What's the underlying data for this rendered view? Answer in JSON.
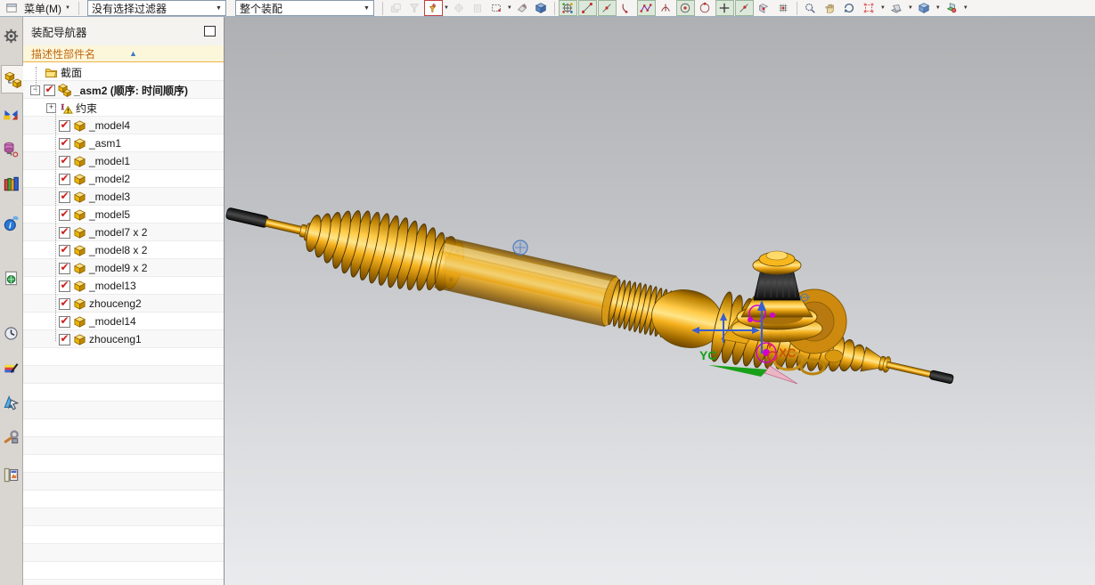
{
  "toolbar": {
    "menu_label": "菜单(M)",
    "selection_filter_value": "没有选择过滤器",
    "scope_value": "整个装配",
    "left_icons": [
      {
        "name": "show-component-icon",
        "state": "disabled"
      },
      {
        "name": "filter-funnel-icon",
        "state": "disabled"
      },
      {
        "name": "snap-filter-icon",
        "state": "red",
        "dropdown": true
      },
      {
        "name": "move-target-icon",
        "state": "disabled"
      },
      {
        "name": "capture-icon",
        "state": "disabled"
      },
      {
        "name": "marquee-select-icon",
        "state": "normal",
        "dropdown": true
      },
      {
        "name": "eraser-icon",
        "state": "normal"
      },
      {
        "name": "work-part-icon",
        "state": "normal"
      }
    ],
    "snap_icons": [
      {
        "name": "snap-point-icon",
        "pressed": true
      },
      {
        "name": "endpoint-icon",
        "pressed": true
      },
      {
        "name": "midpoint-icon",
        "pressed": true
      },
      {
        "name": "arc-point-icon",
        "pressed": false
      },
      {
        "name": "spline-point-icon",
        "pressed": true
      },
      {
        "name": "pole-point-icon",
        "pressed": false
      },
      {
        "name": "center-point-icon",
        "pressed": true
      },
      {
        "name": "quadrant-point-icon",
        "pressed": false
      },
      {
        "name": "intersection-point-icon",
        "pressed": true
      },
      {
        "name": "point-on-curve-icon",
        "pressed": true
      },
      {
        "name": "point-on-face-icon",
        "pressed": false
      },
      {
        "name": "grid-point-icon",
        "pressed": false
      }
    ],
    "view_icons": [
      {
        "name": "zoom-icon"
      },
      {
        "name": "pan-icon"
      },
      {
        "name": "rotate-icon"
      },
      {
        "name": "fit-view-icon",
        "dropdown": true
      },
      {
        "name": "perspective-icon",
        "dropdown": true
      },
      {
        "name": "shaded-view-icon",
        "dropdown": true
      },
      {
        "name": "render-style-icon",
        "dropdown": true
      }
    ]
  },
  "sidebar": {
    "items": [
      {
        "name": "roles-gear-icon",
        "selected": false
      },
      {
        "name": "assembly-navigator-icon",
        "selected": true
      },
      {
        "name": "constraint-navigator-icon",
        "selected": false
      },
      {
        "name": "part-navigator-icon",
        "selected": false
      },
      {
        "name": "reuse-library-icon",
        "selected": false
      },
      {
        "name": "internet-explorer-icon",
        "selected": false
      },
      {
        "name": "web-page-icon",
        "selected": false
      },
      {
        "name": "history-icon",
        "selected": false
      },
      {
        "name": "palette-icon",
        "selected": false
      },
      {
        "name": "pointer-tool-icon",
        "selected": false
      },
      {
        "name": "customize-tools-icon",
        "selected": false
      },
      {
        "name": "gallery-door-icon",
        "selected": false
      }
    ]
  },
  "navigator": {
    "title": "装配导航器",
    "column_header": "描述性部件名",
    "tree": [
      {
        "label": "截面",
        "kind": "section",
        "checked": false,
        "expander": "none",
        "bold": false
      },
      {
        "label": "_asm2 (顺序: 时间顺序)",
        "kind": "assembly",
        "checked": true,
        "expander": "minus",
        "bold": true
      },
      {
        "label": "约束",
        "kind": "constraints",
        "checked": false,
        "expander": "plus",
        "bold": false
      },
      {
        "label": "_model4",
        "kind": "component",
        "checked": true,
        "expander": "none",
        "bold": false
      },
      {
        "label": "_asm1",
        "kind": "component",
        "checked": true,
        "expander": "none",
        "bold": false
      },
      {
        "label": "_model1",
        "kind": "component",
        "checked": true,
        "expander": "none",
        "bold": false
      },
      {
        "label": "_model2",
        "kind": "component",
        "checked": true,
        "expander": "none",
        "bold": false
      },
      {
        "label": "_model3",
        "kind": "component",
        "checked": true,
        "expander": "none",
        "bold": false
      },
      {
        "label": "_model5",
        "kind": "component",
        "checked": true,
        "expander": "none",
        "bold": false
      },
      {
        "label": "_model7 x 2",
        "kind": "component",
        "checked": true,
        "expander": "none",
        "bold": false
      },
      {
        "label": "_model8 x 2",
        "kind": "component",
        "checked": true,
        "expander": "none",
        "bold": false
      },
      {
        "label": "_model9 x 2",
        "kind": "component",
        "checked": true,
        "expander": "none",
        "bold": false
      },
      {
        "label": "_model13",
        "kind": "component",
        "checked": true,
        "expander": "none",
        "bold": false
      },
      {
        "label": "zhouceng2",
        "kind": "component",
        "checked": true,
        "expander": "none",
        "bold": false
      },
      {
        "label": "_model14",
        "kind": "component",
        "checked": true,
        "expander": "none",
        "bold": false
      },
      {
        "label": "zhouceng1",
        "kind": "component",
        "checked": true,
        "expander": "none",
        "bold": false
      }
    ]
  },
  "viewport": {
    "wcs": {
      "x_label": "XC",
      "y_label": "YC"
    },
    "colors": {
      "model_gold": "#f0a800",
      "background_top": "#aeb0b3",
      "background_bottom": "#e9ebed",
      "constraint_magenta": "#d000d0",
      "axis_blue": "#3a5fd0",
      "axis_green": "#18a018"
    }
  }
}
